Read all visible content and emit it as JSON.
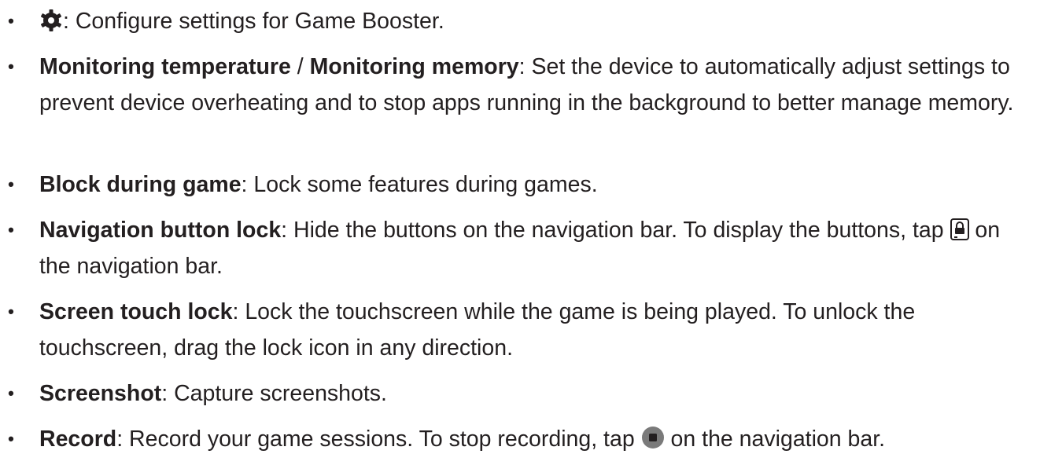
{
  "items": [
    {
      "bullet": "•",
      "icon": "gear-icon",
      "desc": ": Configure settings for Game Booster."
    },
    {
      "bullet": "•",
      "term": "Monitoring temperature",
      "sep": " / ",
      "term2": "Monitoring memory",
      "desc": ": Set the device to automatically adjust settings to prevent device overheating and to stop apps running in the background to better manage memory."
    },
    {
      "bullet": "•",
      "term": "Block during game",
      "desc": ": Lock some features during games."
    },
    {
      "bullet": "•",
      "term": "Navigation button lock",
      "desc": ": Hide the buttons on the navigation bar. To display the buttons, tap",
      "icon": "lock-icon",
      "desc2": " on the navigation bar."
    },
    {
      "bullet": "•",
      "term": "Screen touch lock",
      "desc": ": Lock the touchscreen while the game is being played. To unlock the touchscreen, drag the lock icon in any direction."
    },
    {
      "bullet": "•",
      "term": "Screenshot",
      "desc": ": Capture screenshots."
    },
    {
      "bullet": "•",
      "term": "Record",
      "desc": ": Record your game sessions. To stop recording, tap",
      "icon": "stop-record-icon",
      "desc2": " on the navigation bar."
    }
  ]
}
